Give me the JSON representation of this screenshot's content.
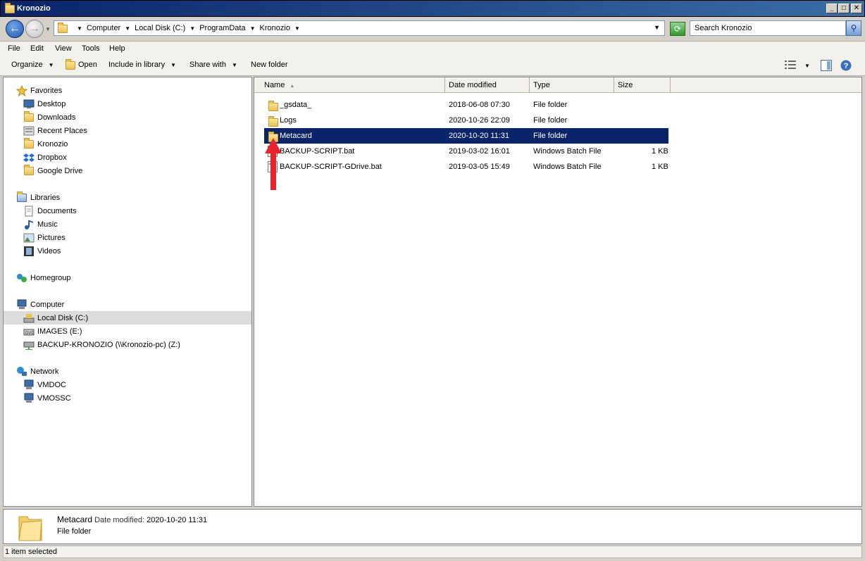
{
  "window": {
    "title": "Kronozio"
  },
  "address": {
    "crumbs": [
      "Computer",
      "Local Disk (C:)",
      "ProgramData",
      "Kronozio"
    ],
    "search_placeholder": "Search Kronozio"
  },
  "menu": [
    "File",
    "Edit",
    "View",
    "Tools",
    "Help"
  ],
  "commands": {
    "organize": "Organize",
    "open": "Open",
    "include": "Include in library",
    "share": "Share with",
    "new_folder": "New folder"
  },
  "nav": {
    "favorites": "Favorites",
    "desktop": "Desktop",
    "downloads": "Downloads",
    "recent": "Recent Places",
    "kronozio": "Kronozio",
    "dropbox": "Dropbox",
    "gdrive": "Google Drive",
    "libraries": "Libraries",
    "documents": "Documents",
    "music": "Music",
    "pictures": "Pictures",
    "videos": "Videos",
    "homegroup": "Homegroup",
    "computer": "Computer",
    "localdisk": "Local Disk (C:)",
    "images": "IMAGES (E:)",
    "backup": "BACKUP-KRONOZIO (\\\\Kronozio-pc) (Z:)",
    "network": "Network",
    "vmdoc": "VMDOC",
    "vmossc": "VMOSSC"
  },
  "columns": {
    "name": "Name",
    "date": "Date modified",
    "type": "Type",
    "size": "Size"
  },
  "files": [
    {
      "name": "_gsdata_",
      "date": "2018-06-08 07:30",
      "type": "File folder",
      "size": ""
    },
    {
      "name": "Logs",
      "date": "2020-10-26 22:09",
      "type": "File folder",
      "size": ""
    },
    {
      "name": "Metacard",
      "date": "2020-10-20 11:31",
      "type": "File folder",
      "size": ""
    },
    {
      "name": "BACKUP-SCRIPT.bat",
      "date": "2019-03-02 16:01",
      "type": "Windows Batch File",
      "size": "1 KB"
    },
    {
      "name": "BACKUP-SCRIPT-GDrive.bat",
      "date": "2019-03-05 15:49",
      "type": "Windows Batch File",
      "size": "1 KB"
    }
  ],
  "details": {
    "name": "Metacard",
    "date_label": "Date modified:",
    "date": "2020-10-20 11:31",
    "type": "File folder"
  },
  "status": "1 item selected",
  "colors": {
    "selection": "#0a246a",
    "arrow": "#e8242c"
  }
}
